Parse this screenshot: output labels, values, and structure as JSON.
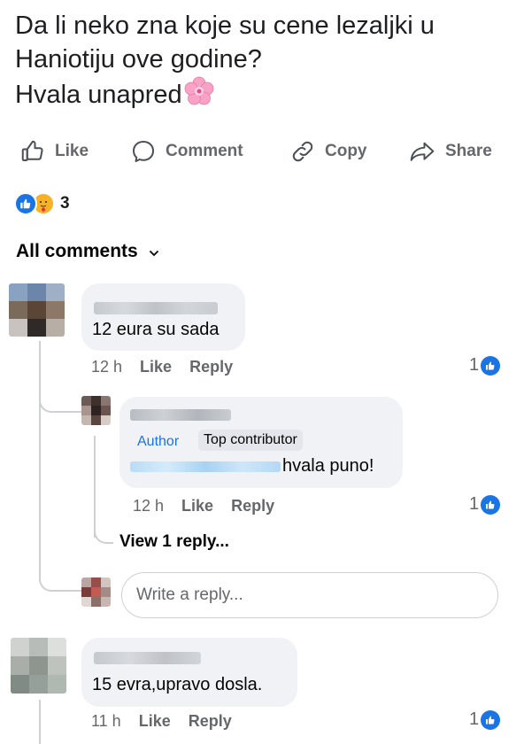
{
  "post": {
    "line1": "Da li neko zna koje su cene lezaljki u",
    "line2": "Haniotiju ove godine?",
    "line3": "Hvala unapred"
  },
  "actions": {
    "like": "Like",
    "comment": "Comment",
    "copy": "Copy",
    "share": "Share"
  },
  "reactions": {
    "count": "3",
    "types": [
      "like",
      "care"
    ]
  },
  "comments_header": {
    "label": "All comments"
  },
  "comments": [
    {
      "text": "12 eura su sada",
      "time": "12 h",
      "like": "Like",
      "reply": "Reply",
      "reaction_count": "1"
    },
    {
      "text": "15 evra,upravo dosla.",
      "time": "11 h",
      "like": "Like",
      "reply": "Reply",
      "reaction_count": "1"
    }
  ],
  "reply": {
    "badge_author": "Author",
    "badge_top": "Top contributor",
    "text": "hvala puno!",
    "time": "12 h",
    "like": "Like",
    "reply": "Reply",
    "reaction_count": "1"
  },
  "view_replies": "View 1 reply...",
  "reply_box": {
    "placeholder": "Write a reply..."
  },
  "colors": {
    "accent": "#1b74e4",
    "bubble": "#f0f2f5",
    "secondary_text": "#65676b"
  }
}
